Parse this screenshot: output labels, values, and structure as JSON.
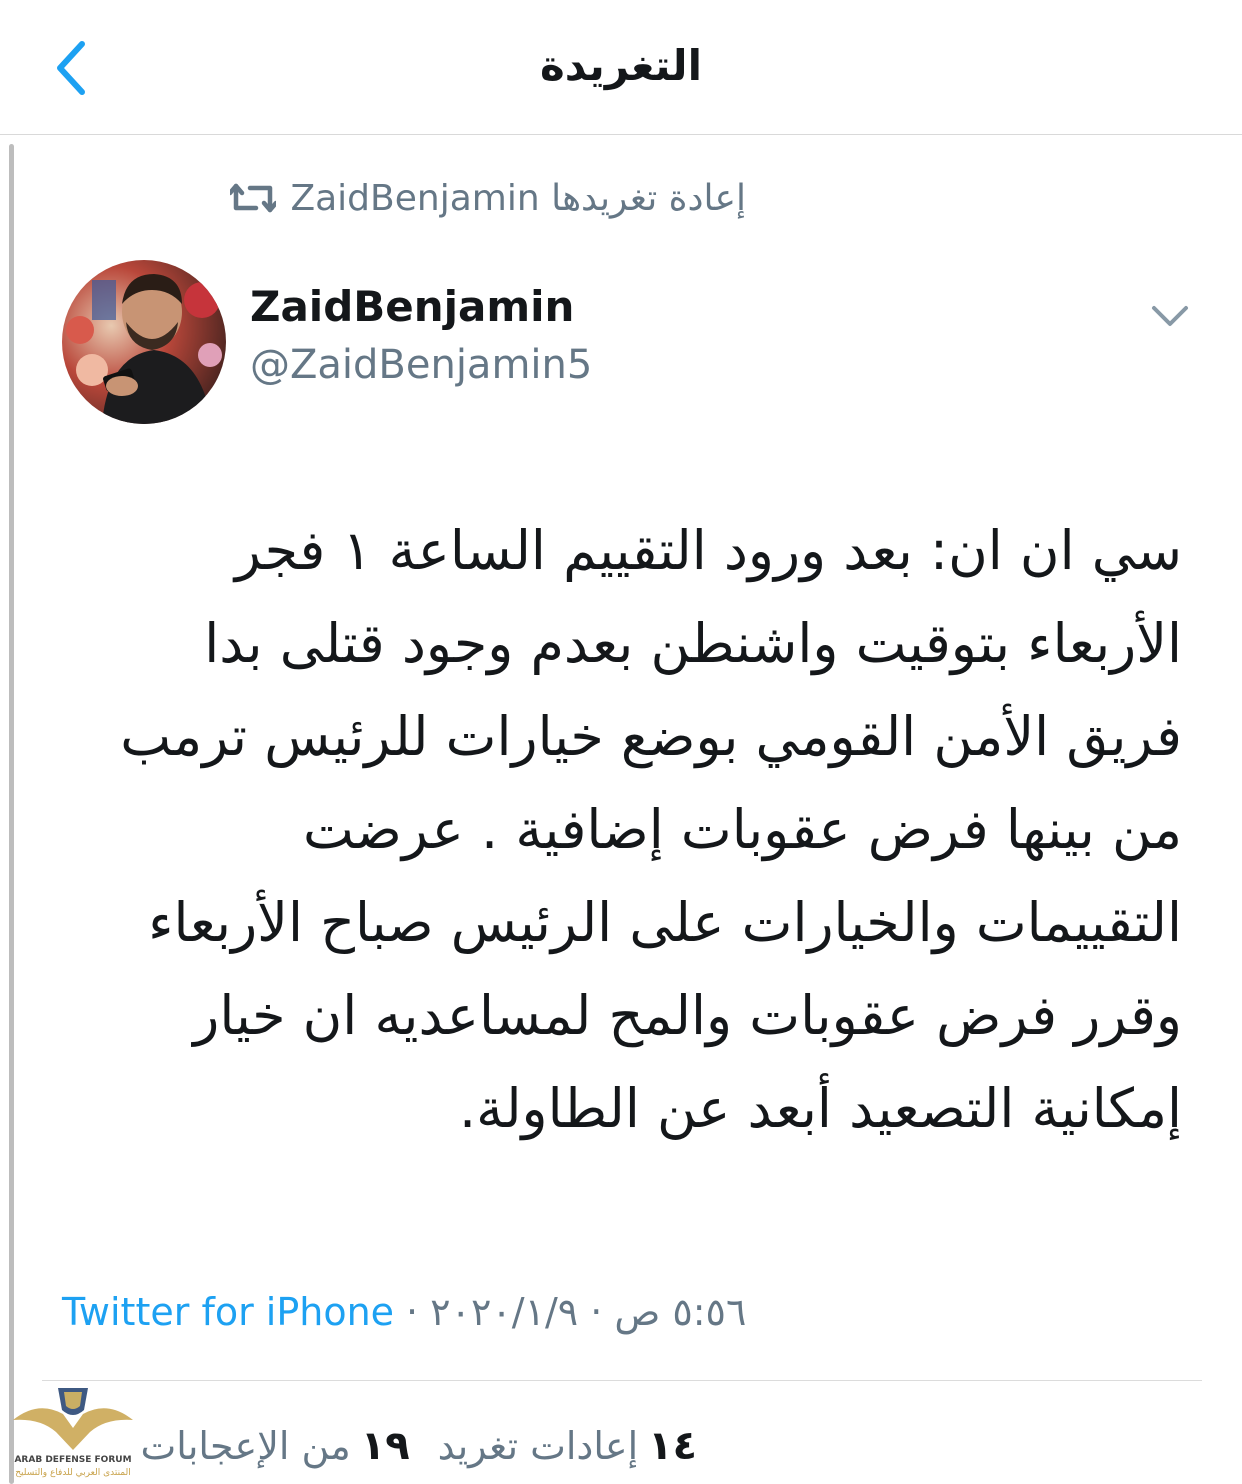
{
  "header": {
    "title": "التغريدة",
    "back_icon": "chevron-left-icon"
  },
  "retweet": {
    "text": "ZaidBenjamin إعادة تغريدها",
    "icon": "retweet-icon"
  },
  "author": {
    "name": "ZaidBenjamin",
    "handle": "@ZaidBenjamin5",
    "menu_icon": "chevron-down-icon"
  },
  "tweet": {
    "lines": [
      "سي ان ان: بعد ورود التقييم الساعة ١ فجر",
      "الأربعاء بتوقيت واشنطن بعدم وجود قتلى بدا",
      "فريق الأمن القومي بوضع خيارات للرئيس ترمب",
      "من بينها فرض عقوبات إضافية . عرضت",
      "التقييمات والخيارات على الرئيس صباح الأربعاء",
      "وقرر فرض عقوبات والمح لمساعديه ان خيار",
      "إمكانية التصعيد أبعد عن الطاولة."
    ]
  },
  "meta": {
    "source": "Twitter for iPhone",
    "separator": "·",
    "date": "٢٠٢٠/١/٩",
    "time": "٥:٥٦ ص"
  },
  "stats": {
    "likes_count": "١٩",
    "likes_label": "من الإعجابات",
    "retweets_count": "١٤",
    "retweets_label": "إعادات تغريد"
  },
  "watermark": {
    "text": "ARAB DEFENSE FORUM",
    "subtext": "المنتدى العربي للدفاع والتسليح"
  },
  "colors": {
    "link": "#1da1f2",
    "muted": "#657786",
    "text": "#14171a"
  }
}
